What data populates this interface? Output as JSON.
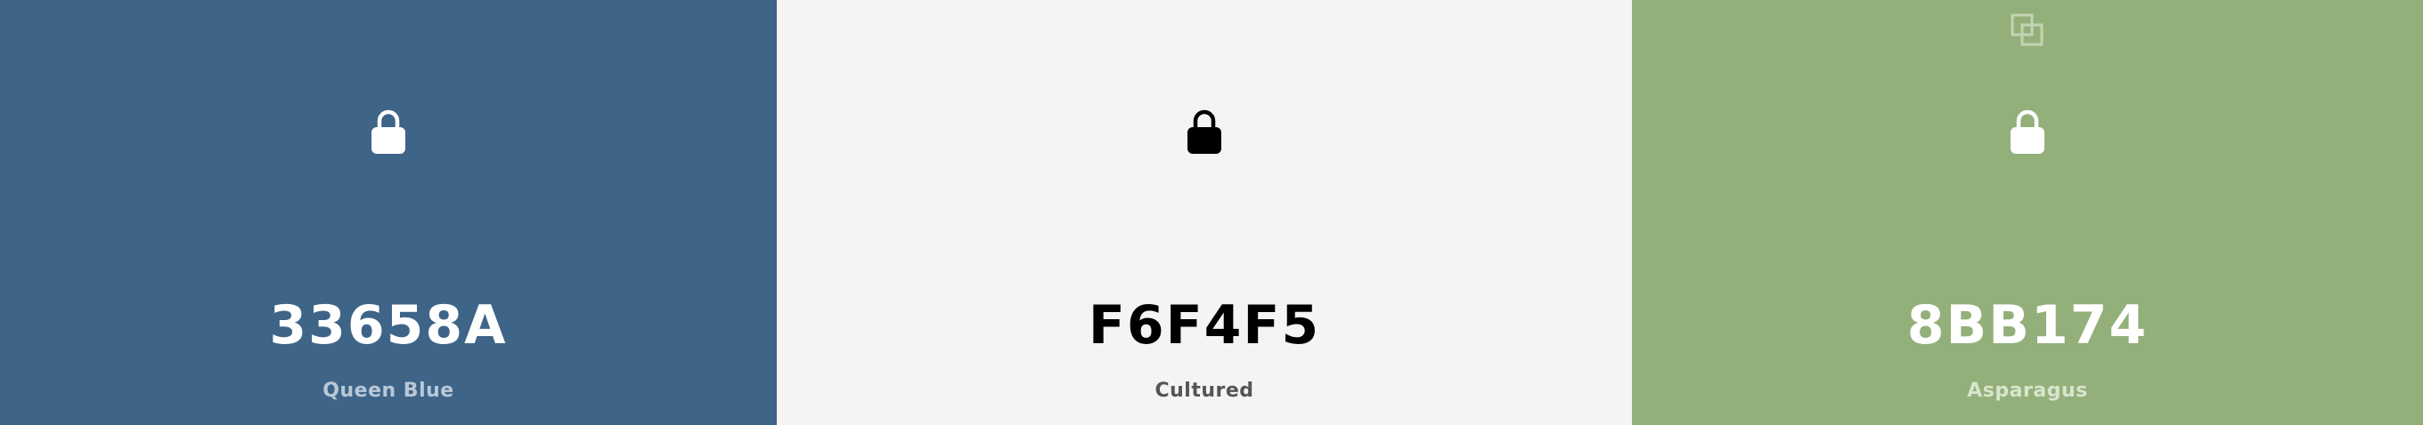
{
  "colors": [
    {
      "hex": "33658A",
      "name": "Queen Blue",
      "background": "#3e6488",
      "hex_color": "#ffffff",
      "name_color": "#b9c8d7",
      "lock_icon": "lock-icon",
      "lock_color": "#ffffff"
    },
    {
      "hex": "F6F4F5",
      "name": "Cultured",
      "background": "#f5f3f4",
      "hex_color": "#000000",
      "name_color": "#555555",
      "lock_icon": "lock-icon",
      "lock_color": "#000000"
    },
    {
      "hex": "8BB174",
      "name": "Asparagus",
      "background": "#93b07a",
      "hex_color": "#ffffff",
      "name_color": "#d8e5cd",
      "lock_icon": "lock-icon",
      "lock_color": "#ffffff",
      "copy_icon": "copy-icon",
      "copy_color": "#c3d4b4"
    }
  ]
}
